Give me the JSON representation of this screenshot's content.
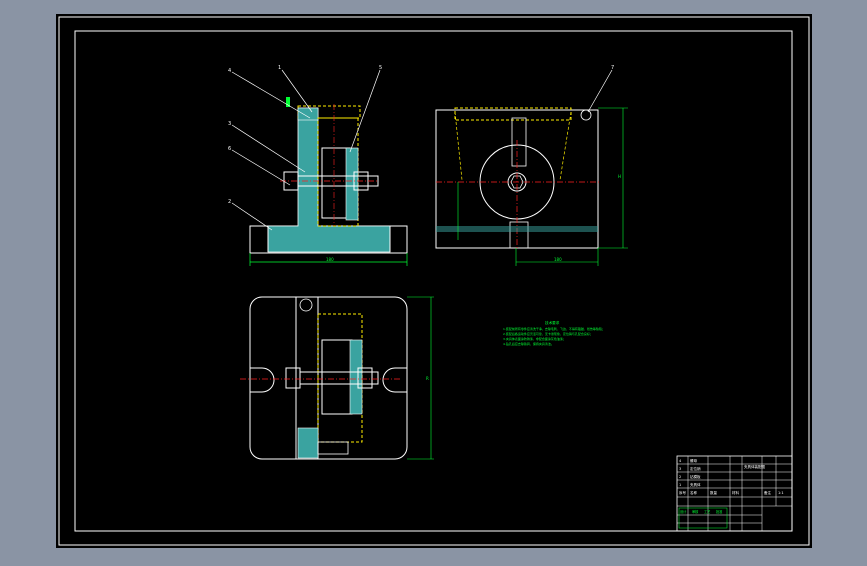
{
  "colors": {
    "background": "#8a94a4",
    "sheet": "#000000",
    "line": "#ffffff",
    "part_fill": "#3aa3a0",
    "yellow": "#ffee00",
    "green": "#00ff33",
    "red": "#ff2020",
    "hatch": "#3aa3a0"
  },
  "balloons": {
    "front_view": [
      "4",
      "1",
      "5",
      "3",
      "6",
      "2"
    ],
    "side_view": [
      "7"
    ]
  },
  "dimensions": {
    "front_width": "180",
    "side_width": "180",
    "side_height": "H",
    "top_height": "R"
  },
  "technical_requirements": {
    "title": "技术要求",
    "lines": [
      "1.装配前所有零件应清洗干净，去除毛刺、飞边，不得有磕碰、划伤等缺陷；",
      "2.装配后各运动件应灵活可靠，无卡滞现象，定位销与孔配合良好；",
      "3.夹具体表面涂防锈漆，非配合面涂灰色油漆；",
      "4.钻孔后应去除铁屑，保持夹具清洁。"
    ]
  },
  "title_block": {
    "rows": [
      [
        "4",
        "螺母",
        "",
        "",
        "",
        "夹具体装配图"
      ],
      [
        "3",
        "定位销",
        "",
        "",
        "",
        ""
      ],
      [
        "2",
        "钻模板",
        "",
        "",
        "",
        ""
      ],
      [
        "1",
        "夹具体",
        "",
        "",
        "",
        ""
      ]
    ],
    "header": [
      "序号",
      "名称",
      "数量",
      "材料",
      "备注",
      "1:1"
    ],
    "footer": [
      "设计",
      "审核",
      "工艺",
      "批准"
    ]
  }
}
